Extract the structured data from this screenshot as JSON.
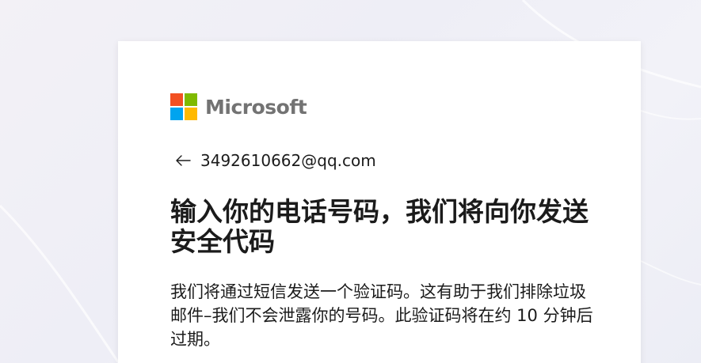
{
  "brand": {
    "name": "Microsoft",
    "colors": [
      "#f25022",
      "#7fba00",
      "#00a4ef",
      "#ffb900"
    ]
  },
  "identity": {
    "back_icon": "arrow-left-icon",
    "email": "3492610662@qq.com"
  },
  "content": {
    "title": "输入你的电话号码，我们将向你发送安全代码",
    "description": "我们将通过短信发送一个验证码。这有助于我们排除垃圾邮件–我们不会泄露你的号码。此验证码将在约 10 分钟后过期。"
  }
}
